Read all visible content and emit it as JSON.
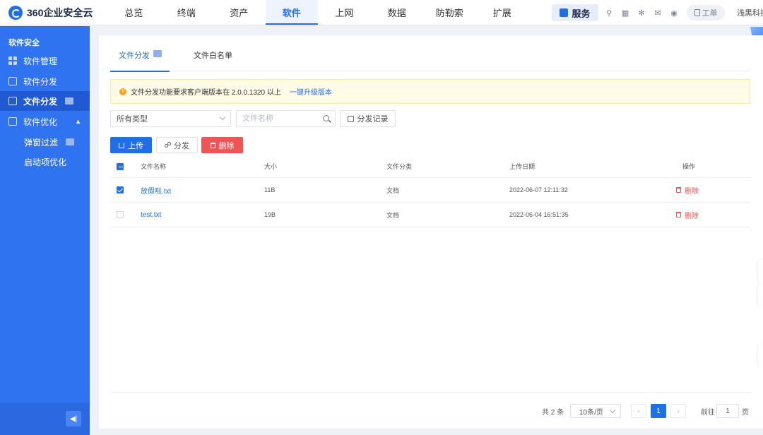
{
  "app": {
    "logo_text": "360企业安全云",
    "company": "浅黑科技"
  },
  "topnav": [
    "总览",
    "终端",
    "资产",
    "软件",
    "上网",
    "数据",
    "防勒索",
    "扩展"
  ],
  "topnav_active": 3,
  "topbar": {
    "service_label": "服务",
    "ticket_label": "工单"
  },
  "sidebar": {
    "section_title": "软件安全",
    "items": [
      {
        "label": "软件管理",
        "icon": "grid-icon"
      },
      {
        "label": "软件分发",
        "icon": "distribute-icon"
      },
      {
        "label": "文件分发",
        "icon": "file-distribute-icon",
        "active": true
      },
      {
        "label": "软件优化",
        "icon": "optimize-icon"
      }
    ],
    "sub_items": [
      "弹窗过滤",
      "启动项优化"
    ]
  },
  "tabs": [
    "文件分发",
    "文件白名单"
  ],
  "notice": {
    "text": "文件分发功能要求客户端版本在 2.0.0.1320 以上",
    "link": "一键升级版本"
  },
  "filters": {
    "type_select": "所有类型",
    "search_placeholder": "文件名称",
    "record_button": "分发记录"
  },
  "actions": {
    "upload": "上传",
    "distribute": "分发",
    "delete": "删除"
  },
  "table": {
    "headers": [
      "文件名称",
      "大小",
      "文件分类",
      "上传日期",
      "操作"
    ],
    "rows": [
      {
        "name": "放假啦.txt",
        "size": "11B",
        "category": "文档",
        "date": "2022-06-07 12:11:32",
        "action": "删除",
        "checked": true
      },
      {
        "name": "test.txt",
        "size": "19B",
        "category": "文档",
        "date": "2022-06-04 16:51:35",
        "action": "删除",
        "checked": false
      }
    ]
  },
  "pagination": {
    "total": "共 2 条",
    "page_size": "10条/页",
    "prev": "‹",
    "current": "1",
    "next": "›",
    "goto_prefix": "前往",
    "goto_value": "1",
    "goto_suffix": "页"
  },
  "colors": {
    "primary": "#1f6fe8",
    "sidebar": "#2f73f0",
    "danger": "#f05454",
    "warning": "#f5a623"
  }
}
